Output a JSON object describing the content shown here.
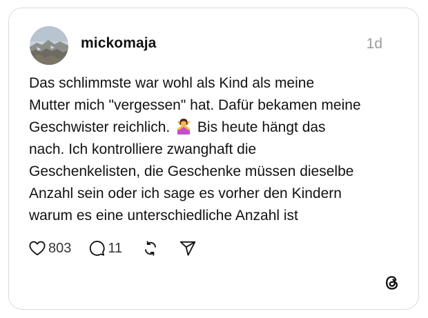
{
  "post": {
    "username": "mickomaja",
    "timestamp": "1d",
    "text_lines": [
      "Das schlimmste war wohl als Kind als meine",
      "Mutter mich \"vergessen\" hat. Dafür bekamen meine",
      "Bis heute hängt das",
      "nach. Ich kontrolliere zwanghaft die",
      "Geschenkelisten, die Geschenke müssen dieselbe",
      "Anzahl sein oder ich sage es vorher den Kindern",
      "warum es eine unterschiedliche Anzahl ist"
    ],
    "line3_before_emoji": "Geschwister reichlich.",
    "emoji": "person-gesturing-no-emoji"
  },
  "actions": {
    "like_count": "803",
    "reply_count": "11",
    "like_icon": "heart-icon",
    "reply_icon": "speech-bubble-icon",
    "repost_icon": "repost-icon",
    "share_icon": "send-icon"
  },
  "brand": {
    "logo": "threads-logo-icon"
  },
  "colors": {
    "text": "#111111",
    "muted": "#9a9a9a",
    "border": "#d9d9d9",
    "emoji_shirt": "#c24fc9",
    "emoji_skin": "#f6b94c"
  }
}
